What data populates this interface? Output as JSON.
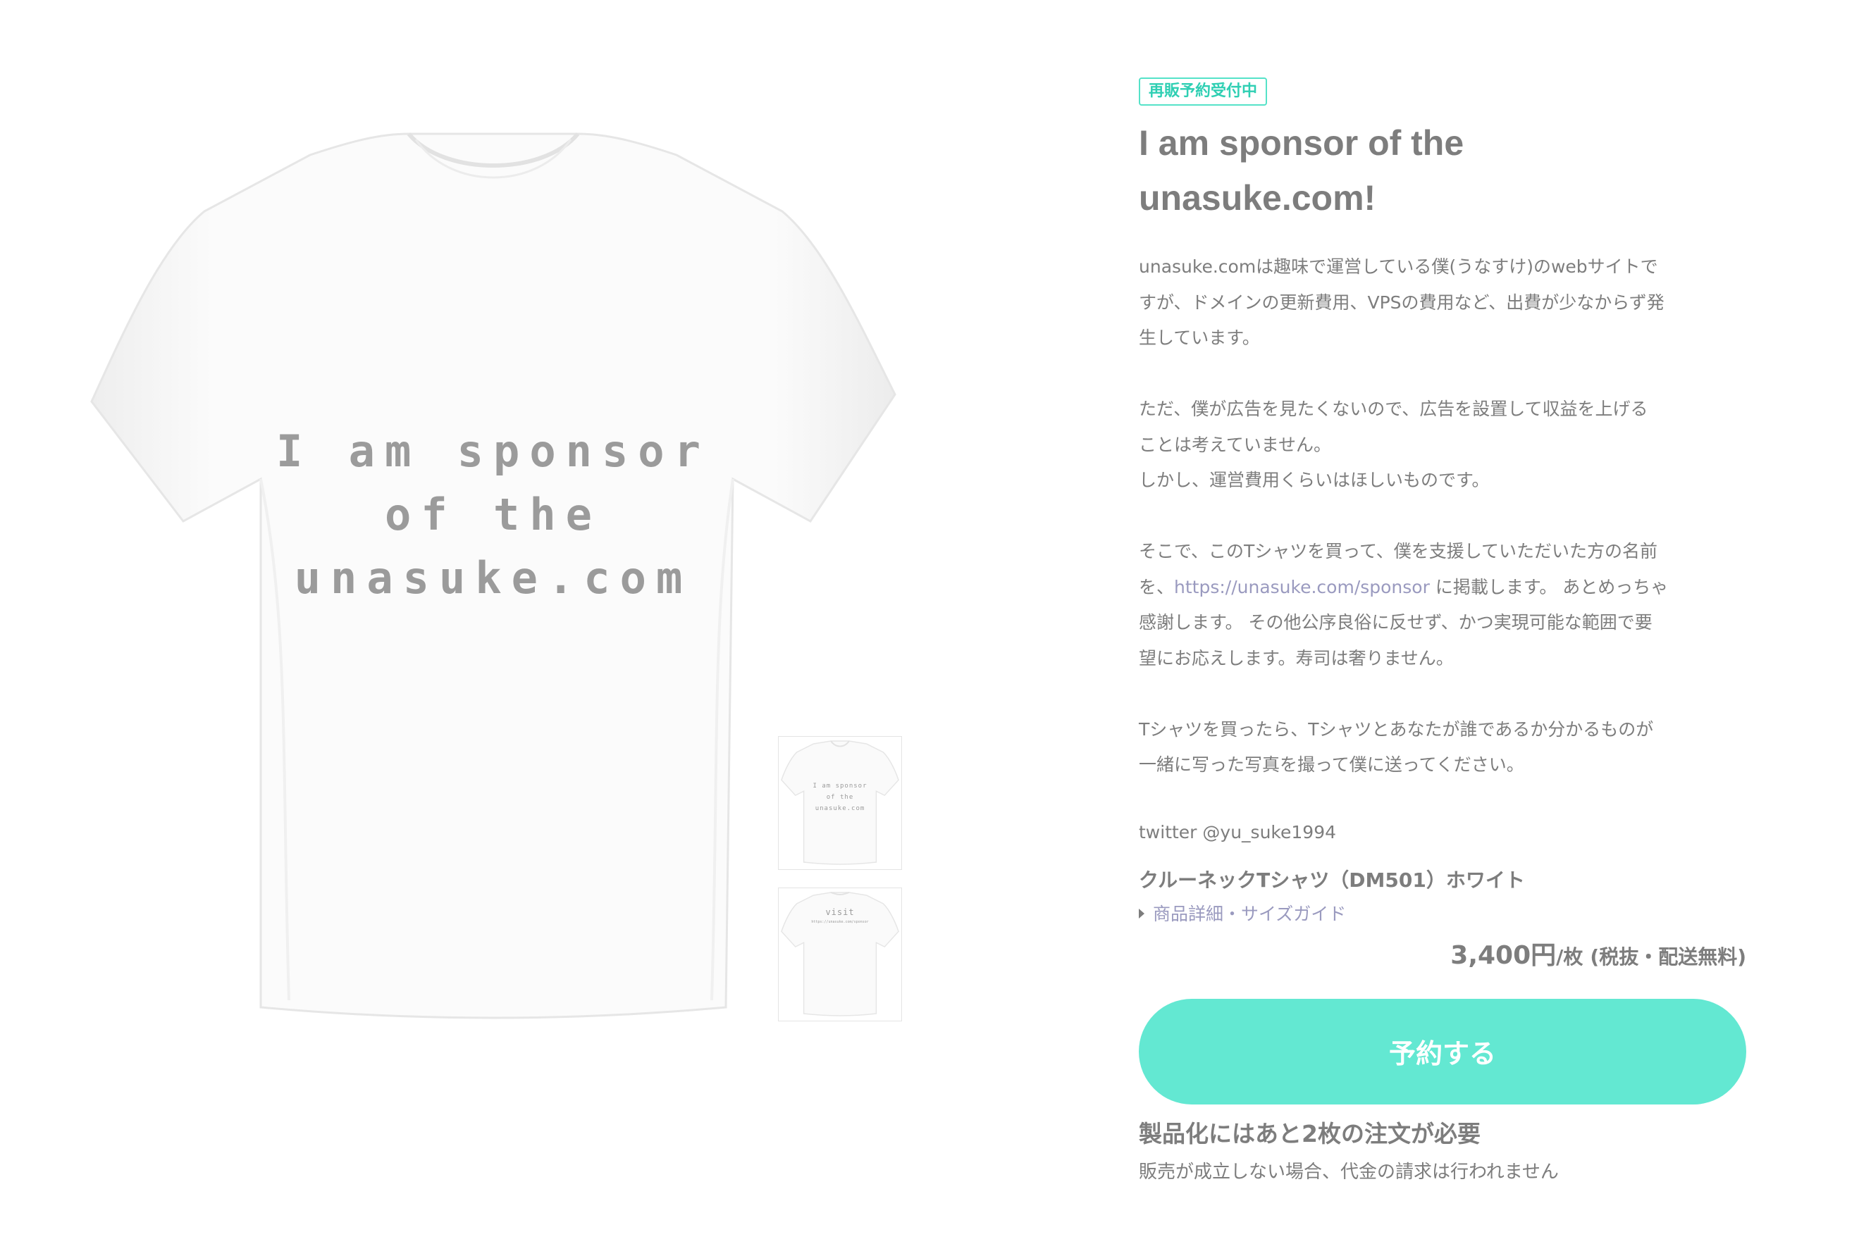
{
  "product": {
    "badge": "再販予約受付中",
    "title": "I am sponsor of the unasuke.com!",
    "description": {
      "p1": "unasuke.comは趣味で運営している僕(うなすけ)のwebサイトで\nすが、ドメインの更新費用、VPSの費用など、出費が少なからず発\n生しています。",
      "p2": "ただ、僕が広告を見たくないので、広告を設置して収益を上げる\nことは考えていません。\nしかし、運営費用くらいはほしいものです。",
      "p3_before": "そこで、このTシャツを買って、僕を支援していただいた方の名前\nを、",
      "p3_link": "https://unasuke.com/sponsor",
      "p3_after": " に掲載します。 あとめっちゃ\n感謝します。 その他公序良俗に反せず、かつ実現可能な範囲で要\n望にお応えします。寿司は奢りません。",
      "p4": "Tシャツを買ったら、Tシャツとあなたが誰であるか分かるものが\n一緒に写った写真を撮って僕に送ってください。"
    },
    "twitter": "twitter @yu_suke1994",
    "item_name": "クルーネックTシャツ（DM501）ホワイト",
    "detail_link": "商品詳細・サイズガイド",
    "price": "3,400円",
    "price_unit": "/枚",
    "price_note": "(税抜・配送無料)",
    "reserve_button": "予約する",
    "requirement": "製品化にはあと2枚の注文が必要",
    "requirement_note": "販売が成立しない場合、代金の請求は行われません"
  },
  "images": {
    "main_print": [
      "I am sponsor",
      "of the",
      "unasuke.com"
    ],
    "thumb1_print": [
      "I am sponsor",
      "of the",
      "unasuke.com"
    ],
    "thumb2_print": [
      "visit",
      "https://unasuke.com/sponsor"
    ]
  },
  "colors": {
    "accent": "#63e8d2",
    "badge": "#55e2c8",
    "text": "#7d7d7d",
    "link": "#9a9abf"
  }
}
